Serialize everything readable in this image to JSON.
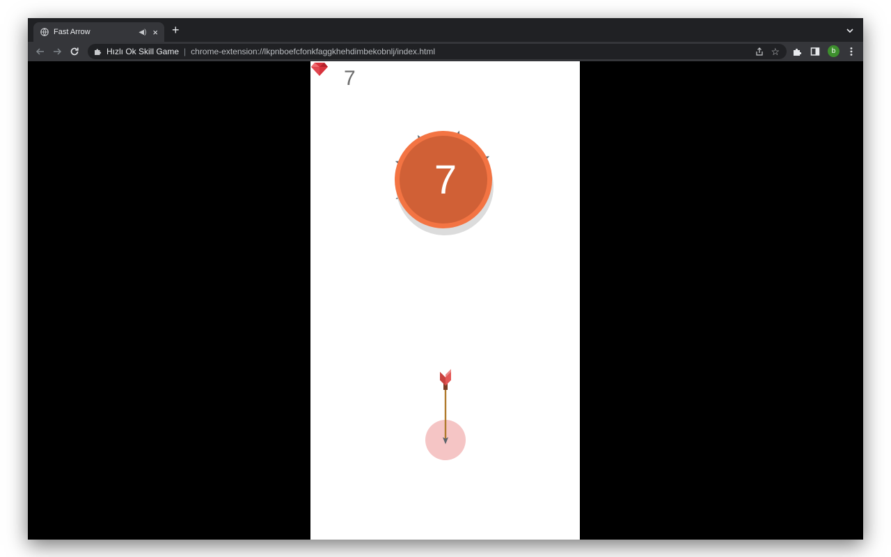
{
  "browser": {
    "tab_title": "Fast Arrow",
    "new_tab_symbol": "+",
    "close_symbol": "×",
    "site_name": "Hızlı Ok Skill Game",
    "separator": "|",
    "url": "chrome-extension://lkpnboefcfonkfaggkhehdimbekobnlj/index.html",
    "profile_initial": "b",
    "profile_color": "#3d8f2d"
  },
  "icons": {
    "tab": [
      "globe-icon",
      "speaker-icon",
      "close-icon"
    ],
    "toolbar": [
      "back-arrow-icon",
      "forward-arrow-icon",
      "reload-icon",
      "puzzle-icon",
      "share-icon",
      "star-icon",
      "extensions-icon",
      "side-panel-icon",
      "kebab-menu-icon"
    ],
    "game": [
      "ruby-gem-icon",
      "arrow-icon"
    ]
  },
  "game": {
    "gem_count": "7",
    "target_count": "7",
    "colors": {
      "target_fill": "#d06036",
      "target_ring": "#f37443",
      "target_shadow": "#dcdcdc",
      "shooter_circle": "#f5c5c5",
      "arrow_shaft": "#b07a2c",
      "arrow_head": "#5b646b",
      "arrow_fletching": "#e45756"
    },
    "stuck_arrow_angles_deg": [
      -27,
      70,
      158,
      201,
      240,
      288,
      333
    ],
    "loaded_arrows": 1
  }
}
